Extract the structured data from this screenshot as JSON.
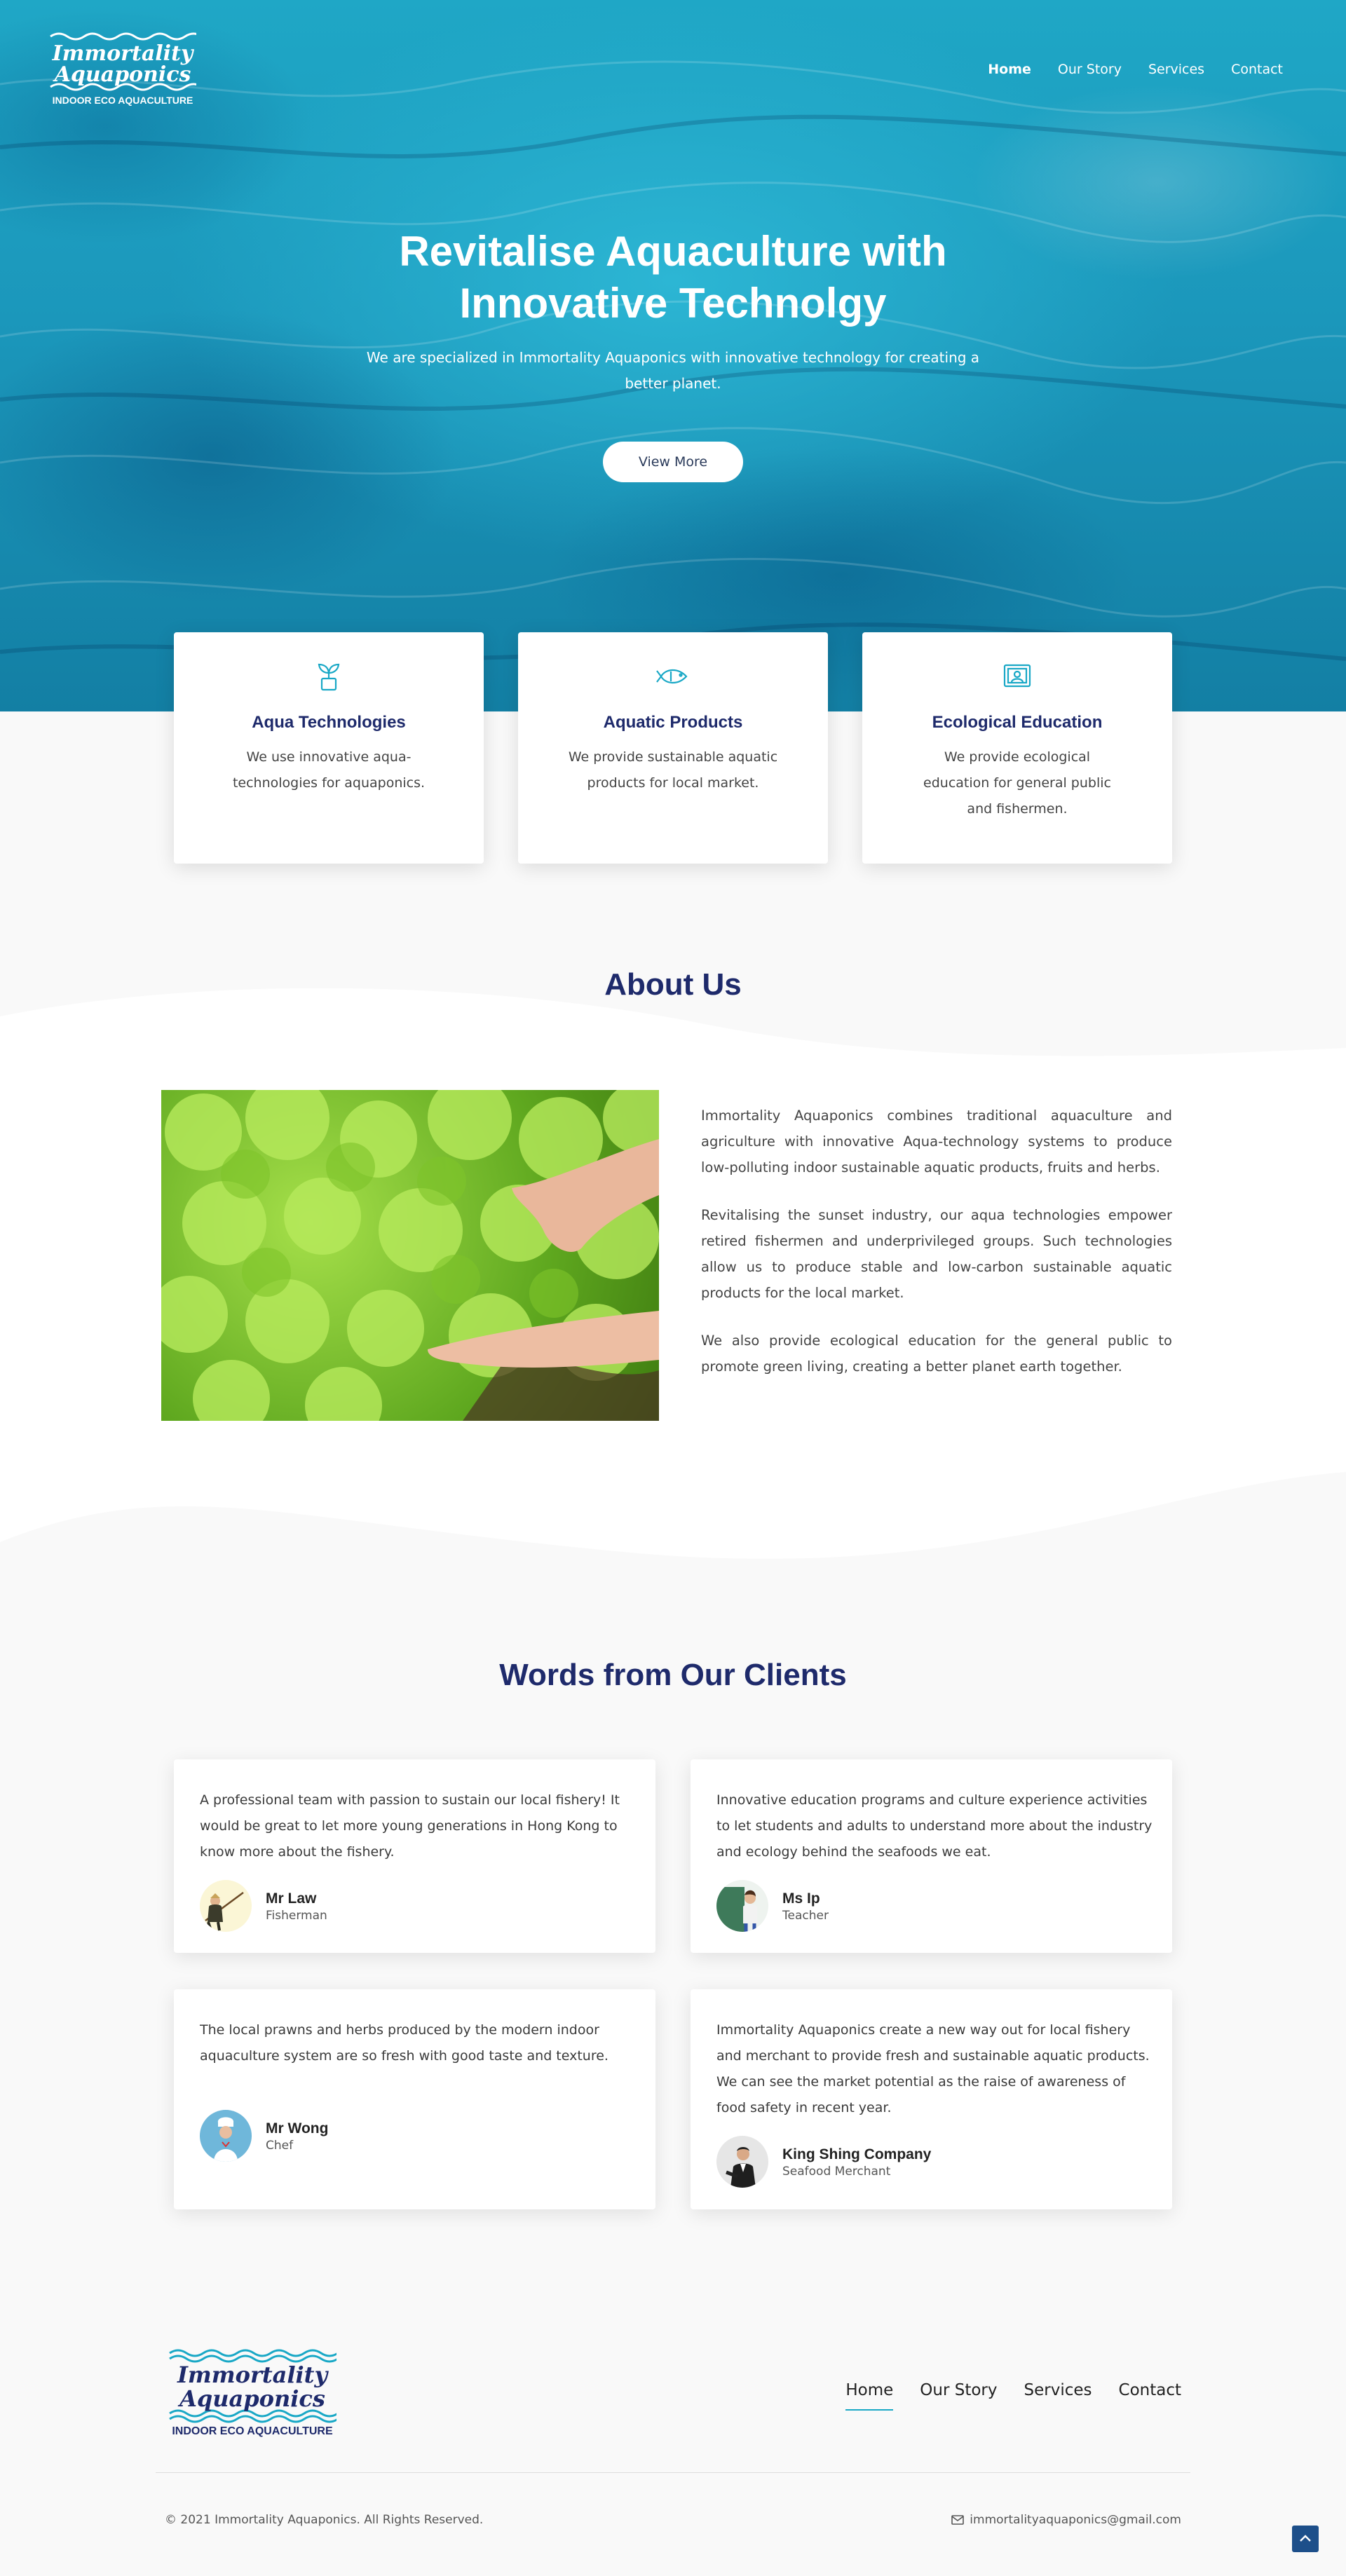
{
  "brand": {
    "logo_line1": "Immortality",
    "logo_line2": "Aquaponics",
    "logo_tagline": "INDOOR ECO AQUACULTURE"
  },
  "nav": {
    "items": [
      {
        "label": "Home",
        "active": true
      },
      {
        "label": "Our Story",
        "active": false
      },
      {
        "label": "Services",
        "active": false
      },
      {
        "label": "Contact",
        "active": false
      }
    ]
  },
  "hero": {
    "title_line1": "Revitalise Aquaculture with",
    "title_line2": "Innovative Technolgy",
    "subtitle_line1": "We are specialized in Immortality Aquaponics with innovative technology for creating a",
    "subtitle_line2": "better planet.",
    "button_label": "View More"
  },
  "features": [
    {
      "icon": "plant-pot-icon",
      "title": "Aqua Technologies",
      "text": "We use innovative aqua-technologies for aquaponics."
    },
    {
      "icon": "fish-icon",
      "title": "Aquatic Products",
      "text": "We provide sustainable aquatic products for local market."
    },
    {
      "icon": "presentation-icon",
      "title": "Ecological Education",
      "text": "We provide ecological education for general public and fishermen."
    }
  ],
  "about": {
    "title": "About Us",
    "paragraphs": [
      "Immortality Aquaponics combines traditional aquaculture and agriculture with innovative Aqua-technology systems to produce low-polluting indoor sustainable aquatic products, fruits and herbs.",
      "Revitalising the sunset industry, our aqua technologies empower retired fishermen and underprivileged groups. Such technologies allow us to produce stable and low-carbon sustainable aquatic products for the local market.",
      "We also provide ecological education for the general public to promote green living, creating a better planet earth together."
    ]
  },
  "clients": {
    "title": "Words from Our Clients",
    "testimonials": [
      {
        "quote": "A professional team with passion to sustain our local fishery! It would be great to let more young generations in Hong Kong to know more about the fishery.",
        "name": "Mr Law",
        "role": "Fisherman"
      },
      {
        "quote": "Innovative education programs and culture experience activities to let students and adults to understand more about the industry and ecology behind the seafoods we eat.",
        "name": "Ms Ip",
        "role": "Teacher"
      },
      {
        "quote": "The local prawns and herbs produced by the modern indoor aquaculture system are so fresh with good taste and texture.",
        "name": "Mr Wong",
        "role": "Chef"
      },
      {
        "quote": "Immortality Aquaponics create a new way out for local fishery and merchant to provide fresh and sustainable aquatic products. We can see the market potential as the raise of awareness of food safety in recent year.",
        "name": "King Shing Company",
        "role": "Seafood Merchant"
      }
    ]
  },
  "footer": {
    "copyright": "© 2021 Immortality Aquaponics. All Rights Reserved.",
    "email": "immortalityaquaponics@gmail.com"
  },
  "colors": {
    "heading_navy": "#1e2a6b",
    "accent_cyan": "#19a8c6",
    "hero_blue": "#1fa7c6"
  }
}
